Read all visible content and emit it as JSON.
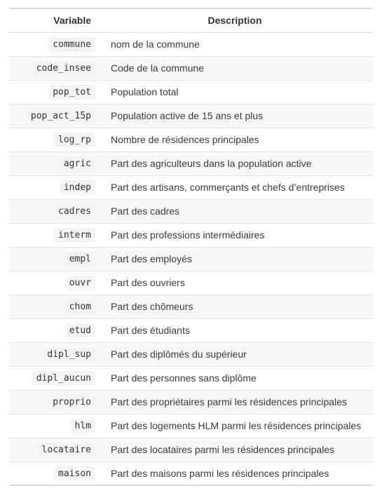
{
  "table": {
    "headers": {
      "variable": "Variable",
      "description": "Description"
    },
    "rows": [
      {
        "variable": "commune",
        "description": "nom de la commune"
      },
      {
        "variable": "code_insee",
        "description": "Code de la commune"
      },
      {
        "variable": "pop_tot",
        "description": "Population total"
      },
      {
        "variable": "pop_act_15p",
        "description": "Population active de 15 ans et plus"
      },
      {
        "variable": "log_rp",
        "description": "Nombre de résidences principales"
      },
      {
        "variable": "agric",
        "description": "Part des agriculteurs dans la population active"
      },
      {
        "variable": "indep",
        "description": "Part des artisans, commerçants et chefs d’entreprises"
      },
      {
        "variable": "cadres",
        "description": "Part des cadres"
      },
      {
        "variable": "interm",
        "description": "Part des professions intermédiaires"
      },
      {
        "variable": "empl",
        "description": "Part des employés"
      },
      {
        "variable": "ouvr",
        "description": "Part des ouvriers"
      },
      {
        "variable": "chom",
        "description": "Part des chômeurs"
      },
      {
        "variable": "etud",
        "description": "Part des étudiants"
      },
      {
        "variable": "dipl_sup",
        "description": "Part des diplômés du supérieur"
      },
      {
        "variable": "dipl_aucun",
        "description": "Part des personnes sans diplôme"
      },
      {
        "variable": "proprio",
        "description": "Part des propriétaires parmi les résidences principales"
      },
      {
        "variable": "hlm",
        "description": "Part des logements HLM parmi les résidences principales"
      },
      {
        "variable": "locataire",
        "description": "Part des locataires parmi les résidences principales"
      },
      {
        "variable": "maison",
        "description": "Part des maisons parmi les résidences principales"
      }
    ]
  }
}
